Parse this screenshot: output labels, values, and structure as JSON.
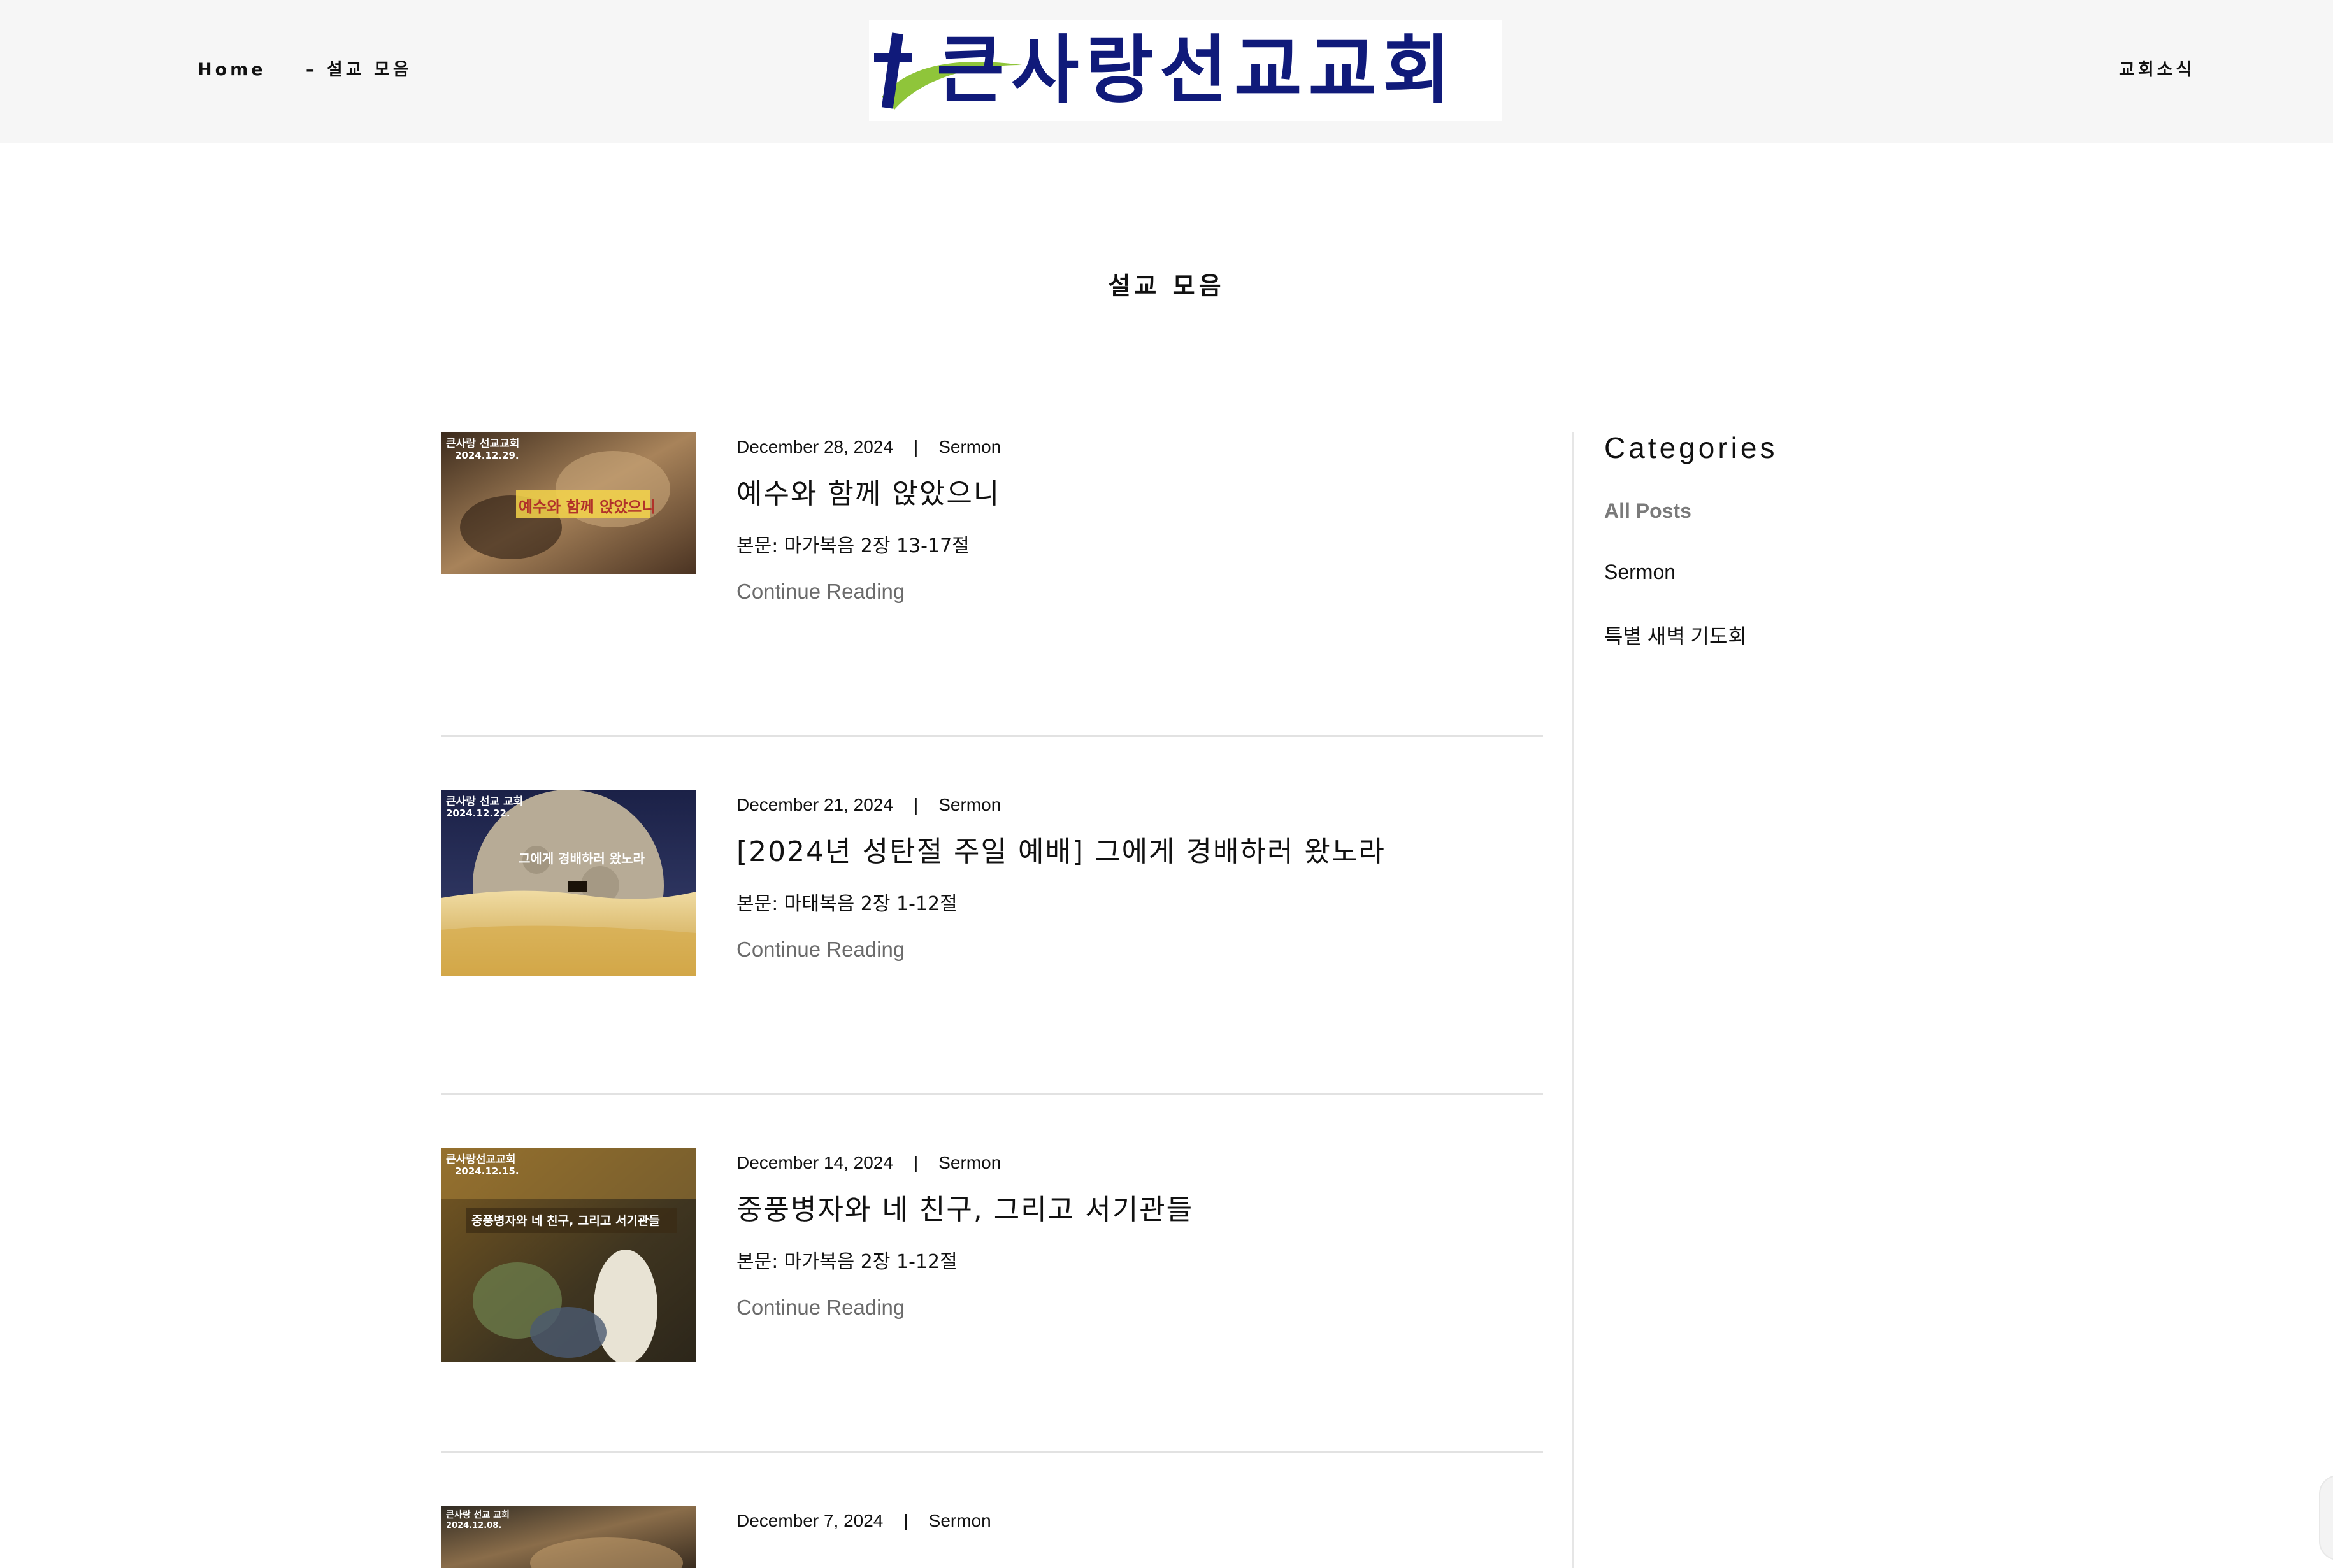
{
  "header": {
    "nav_home": "Home",
    "nav_sermons": "– 설교 모음",
    "nav_news": "교회소식",
    "logo_text": "큰사랑선교교회"
  },
  "page_title": "설교 모음",
  "posts": [
    {
      "date": "December 28, 2024",
      "separator": "|",
      "category": "Sermon",
      "title": "예수와 함께 앉았으니",
      "text": "본문: 마가복음 2장 13-17절",
      "continue": "Continue Reading",
      "thumb": {
        "church": "큰사랑 선교교회",
        "date": "2024.12.29.",
        "caption": "예수와 함께 앉았으니"
      }
    },
    {
      "date": "December 21, 2024",
      "separator": "|",
      "category": "Sermon",
      "title": "[2024년 성탄절 주일 예배] 그에게 경배하러 왔노라",
      "text": "본문: 마태복음 2장 1-12절",
      "continue": "Continue Reading",
      "thumb": {
        "church": "큰사랑 선교 교회",
        "date": "2024.12.22.",
        "caption": "그에게 경배하러 왔노라"
      }
    },
    {
      "date": "December 14, 2024",
      "separator": "|",
      "category": "Sermon",
      "title": "중풍병자와 네 친구, 그리고 서기관들",
      "text": "본문: 마가복음 2장 1-12절",
      "continue": "Continue Reading",
      "thumb": {
        "church": "큰사랑선교교회",
        "date": "2024.12.15.",
        "caption": "중풍병자와 네 친구, 그리고 서기관들"
      }
    },
    {
      "date": "December 7, 2024",
      "separator": "|",
      "category": "Sermon",
      "title": "",
      "text": "",
      "continue": "",
      "thumb": {
        "church": "큰사랑 선교 교회",
        "date": "2024.12.08.",
        "caption": ""
      }
    }
  ],
  "sidebar": {
    "heading": "Categories",
    "items": [
      {
        "label": "All Posts",
        "active": true
      },
      {
        "label": "Sermon",
        "active": false
      },
      {
        "label": "특별 새벽 기도회",
        "active": false
      }
    ]
  },
  "colors": {
    "header_bg": "#f6f6f6",
    "logo_text": "#101a7a",
    "logo_swoosh": "#8fc53a",
    "continue_link": "#6b6b6b",
    "divider": "#e2e2e2"
  }
}
